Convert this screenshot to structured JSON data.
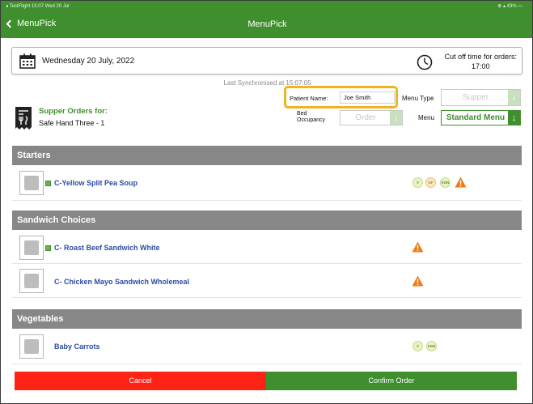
{
  "status_bar": {
    "left": "◂ TestFlight  15:07  Wed 20 Jul",
    "right": "⊕ ▴ 43% ▭"
  },
  "nav": {
    "back_label": "MenuPick",
    "title": "MenuPick"
  },
  "date_bar": {
    "date": "Wednesday 20 July, 2022",
    "cutoff_label": "Cut off time for orders:",
    "cutoff_time": "17:00"
  },
  "last_sync": "Last Synchronised at 15:07:05",
  "order_header": {
    "orders_for_label": "Supper Orders for:",
    "ward": "Safe Hand Three - 1",
    "patient_label": "Patient Name:",
    "patient_name": "Joe Smith",
    "menu_type_label": "Menu Type",
    "menu_type_value": "Supper",
    "bed_label_line1": "Bed",
    "bed_label_line2": "Occupancy",
    "bed_value": "Order",
    "menu_label": "Menu",
    "menu_value": "Standard Menu"
  },
  "sections": [
    {
      "title": "Starters",
      "items": [
        {
          "name": "C-Yellow Split Pea Soup",
          "badges": [
            "V",
            "GF",
            "VGN"
          ],
          "warning": true,
          "selected": true
        }
      ]
    },
    {
      "title": "Sandwich Choices",
      "items": [
        {
          "name": "C- Roast Beef Sandwich White",
          "badges": [],
          "warning": true,
          "selected": true
        },
        {
          "name": "C- Chicken Mayo Sandwich Wholemeal",
          "badges": [],
          "warning": true,
          "selected": false
        }
      ]
    },
    {
      "title": "Vegetables",
      "items": [
        {
          "name": "Baby Carrots",
          "badges": [
            "V",
            "VGN"
          ],
          "warning": false,
          "selected": false
        }
      ]
    }
  ],
  "buttons": {
    "cancel": "Cancel",
    "confirm": "Confirm Order"
  },
  "colors": {
    "brand_green": "#3f8f2e",
    "highlight": "#f0b322",
    "cancel_red": "#ff2316",
    "warning_orange": "#f07b1a",
    "item_blue": "#2c4ca6"
  }
}
